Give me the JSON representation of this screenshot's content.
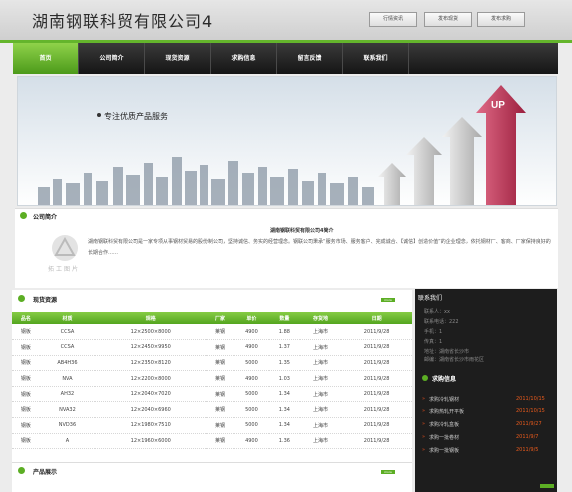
{
  "header": {
    "site_title": "湖南钢联科贸有限公司4",
    "buttons": [
      "行情资讯",
      "发布现货",
      "发布求购"
    ]
  },
  "nav": {
    "items": [
      "首页",
      "公司简介",
      "现货资源",
      "求购信息",
      "留言反馈",
      "联系我们"
    ],
    "active_index": 0
  },
  "banner": {
    "slogan": "专注优质产品服务",
    "badge": "UP"
  },
  "intro": {
    "section_title": "公司简介",
    "company_name": "湖南钢联科贸有限公司4简介",
    "text": "湖南钢联科贸有限公司是一家专项从事钢材贸易的股份制公司，坚持诚信、务实的经营理念。钢联公司秉承“服务市场、服务客户、完成诚合、【诚信】创造价值”的企业理念，依托钢材厂、客商、厂家保持良好的长期合作……",
    "logo_text": "拓工图片"
  },
  "stock": {
    "section_title": "现货资源",
    "more_label": "more",
    "columns": [
      "品名",
      "材质",
      "规格",
      "厂家",
      "单价",
      "数量",
      "存货地",
      "日期"
    ],
    "rows": [
      [
        "钢板",
        "CCSA",
        "12×2500×8000",
        "莱钢",
        "4900",
        "1.88",
        "上海市",
        "2011/9/28"
      ],
      [
        "钢板",
        "CCSA",
        "12×2450×9950",
        "莱钢",
        "4900",
        "1.37",
        "上海市",
        "2011/9/28"
      ],
      [
        "钢板",
        "AB4H36",
        "12×2350×8120",
        "莱钢",
        "5000",
        "1.35",
        "上海市",
        "2011/9/28"
      ],
      [
        "钢板",
        "NVA",
        "12×2200×8000",
        "莱钢",
        "4900",
        "1.03",
        "上海市",
        "2011/9/28"
      ],
      [
        "钢板",
        "AH32",
        "12×2040×7020",
        "莱钢",
        "5000",
        "1.34",
        "上海市",
        "2011/9/28"
      ],
      [
        "钢板",
        "NVA32",
        "12×2040×6960",
        "莱钢",
        "5000",
        "1.34",
        "上海市",
        "2011/9/28"
      ],
      [
        "钢板",
        "NVD36",
        "12×1980×7510",
        "莱钢",
        "5000",
        "1.34",
        "上海市",
        "2011/9/28"
      ],
      [
        "钢板",
        "A",
        "12×1960×6000",
        "莱钢",
        "4900",
        "1.36",
        "上海市",
        "2011/9/28"
      ]
    ]
  },
  "products": {
    "section_title": "产品展示",
    "more_label": "more"
  },
  "contact": {
    "title": "联系我们",
    "lines": [
      "联系人：xx",
      "联系电话：222",
      "手机：1",
      "传真：1",
      "地址：湖南省长沙市",
      "邮编：湖南省长沙市雨花区"
    ]
  },
  "purchase": {
    "title": "求购信息",
    "items": [
      {
        "title": "求购冷轧钢材",
        "date": "2011/10/15"
      },
      {
        "title": "求购热轧开平板",
        "date": "2011/10/15"
      },
      {
        "title": "求购冷轧盒板",
        "date": "2011/9/27"
      },
      {
        "title": "求购一批卷材",
        "date": "2011/9/7"
      },
      {
        "title": "求购一批钢板",
        "date": "2011/9/5"
      }
    ]
  },
  "colors": {
    "accent_green": "#64b52c",
    "nav_dark": "#1e1e1e",
    "date_orange": "#e85a1c",
    "arrow_red": "#c0395a"
  }
}
